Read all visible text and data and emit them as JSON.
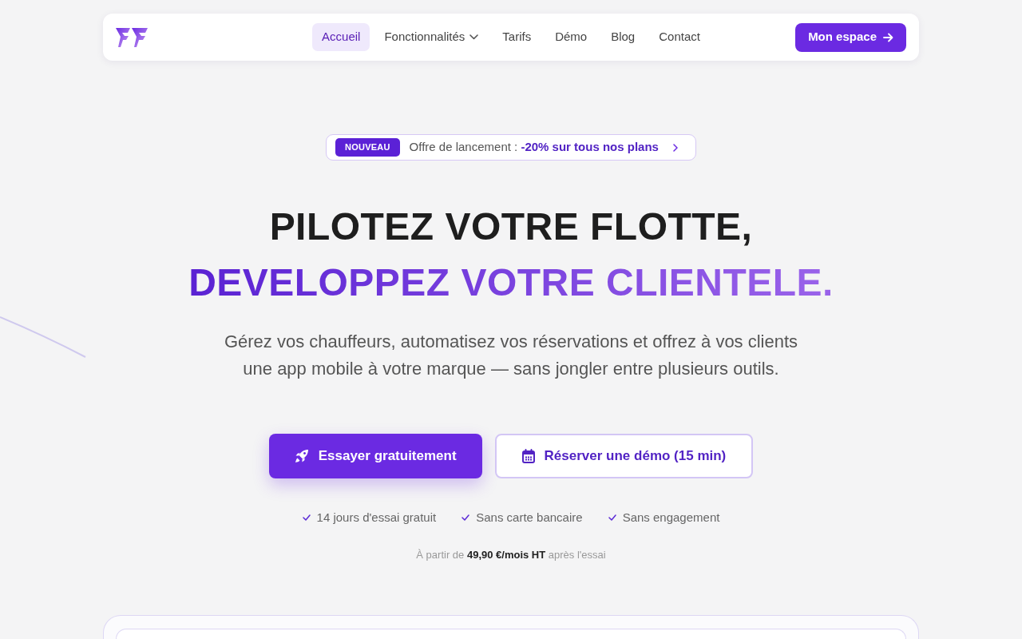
{
  "navbar": {
    "nav_items": [
      {
        "label": "Accueil",
        "selected": true,
        "dropdown": false
      },
      {
        "label": "Fonctionnalités",
        "selected": false,
        "dropdown": true
      },
      {
        "label": "Tarifs",
        "selected": false,
        "dropdown": false
      },
      {
        "label": "Démo",
        "selected": false,
        "dropdown": false
      },
      {
        "label": "Blog",
        "selected": false,
        "dropdown": false
      },
      {
        "label": "Contact",
        "selected": false,
        "dropdown": false
      }
    ],
    "cta": "Mon espace"
  },
  "announcement": {
    "badge": "NOUVEAU",
    "text": "Offre de lancement :",
    "highlight": "-20% sur tous nos plans"
  },
  "hero": {
    "title_line_1": "PILOTEZ VOTRE FLOTTE,",
    "title_line_2": "DEVELOPPEZ VOTRE CLIENTELE.",
    "subtitle": "Gérez vos chauffeurs, automatisez vos réservations et offrez à vos clients une app mobile à votre marque — sans jongler entre plusieurs outils.",
    "primary_button": "Essayer gratuitement",
    "secondary_button": "Réserver une démo (15 min)",
    "perks": [
      "14 jours d'essai gratuit",
      "Sans carte bancaire",
      "Sans engagement"
    ],
    "pricing_note": "À partir de **49,90 €/mois HT** après l'essai"
  }
}
